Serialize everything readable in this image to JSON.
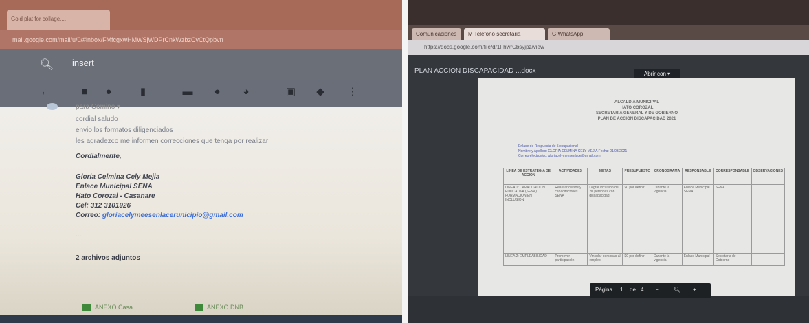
{
  "left": {
    "tab_title": "Gold plat for collage....",
    "address": "mail.google.com/mail/u/0/#inbox/FMfcgxwHMWSjWDPrCnkWzbzCyCtQpbvn",
    "search_value": "insert",
    "toolbar_icons": [
      "back-arrow-icon",
      "archive-icon",
      "report-spam-icon",
      "delete-icon",
      "mark-unread-icon",
      "snooze-icon",
      "add-task-icon",
      "move-to-icon",
      "label-icon",
      "more-icon"
    ],
    "to_line": "para Comino ▾",
    "body_lines": [
      "cordial saludo",
      "envio los formatos diligenciados",
      "les agradezco me informen correcciones que tenga por realizar"
    ],
    "closing": "Cordialmente,",
    "signature": [
      "Gloria Celmina Cely Mejia",
      "Enlace Municipal SENA",
      "Hato Corozal - Casanare",
      "Cel: 312 3101926"
    ],
    "email_label": "Correo:",
    "email": "gloriacelymeesenlacerunicipio@gmail.com",
    "ellipsis": "...",
    "attachments_header": "2 archivos adjuntos",
    "attachments": [
      "ANEXO Casa...",
      "ANEXO DNB..."
    ]
  },
  "right": {
    "tabs": [
      "Comunicaciones",
      "M Teléfono secretaria",
      "G WhatsApp"
    ],
    "address": "https://docs.google.com/file/d/1FhwrCbsyjpz/view",
    "file_title": "PLAN ACCION DISCAPACIDAD ...docx",
    "open_with": "Abrir con ▾",
    "doc_heading": [
      "ALCALDIA MUNICIPAL",
      "HATO COROZAL",
      "SECRETARIA GENERAL Y DE GOBIERNO",
      "PLAN DE ACCION DISCAPACIDAD 2021"
    ],
    "doc_meta": [
      "Enlace de Respuesta de 5 ocupacional",
      "Nombre y Apellido: GLORIA CELMINA CELY MEJIA  Fecha: 01/03/2021",
      "Correo electronico: gloriacelymeesenlace@gmail.com"
    ],
    "table_headers": [
      "LINEA DE ESTRATEGIA DE ACCION",
      "ACTIVIDADES",
      "METAS",
      "PRESUPUESTO",
      "CRONOGRAMA",
      "RESPONSABLE",
      "CORRESPONSABLE",
      "OBSERVACIONES"
    ],
    "table_rows": [
      [
        "LINEA 1: CAPACITACION EDUCATIVA (SENA) FORMACION EN INCLUSION",
        "Realizar cursos y capacitaciones SENA",
        "Lograr inclusión de 20 personas con discapacidad",
        "$0 por definir",
        "Durante la vigencia",
        "Enlace Municipal SENA",
        "SENA",
        ""
      ],
      [
        "LINEA 2: EMPLEABILIDAD",
        "Promover participación",
        "Vincular personas al empleo",
        "$0 por definir",
        "Durante la vigencia",
        "Enlace Municipal",
        "Secretaria de Gobierno",
        ""
      ]
    ],
    "pager_label": "Página",
    "pager_page": "1",
    "pager_sep": "de",
    "pager_total": "4"
  }
}
